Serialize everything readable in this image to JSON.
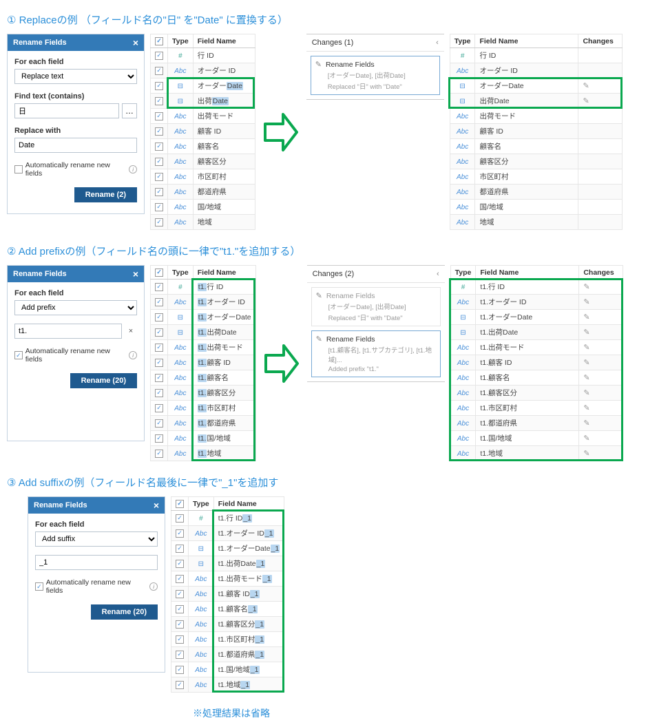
{
  "sec1": {
    "title": "① Replaceの例 （フィールド名の\"日\" を\"Date\" に置換する）",
    "panel": {
      "header": "Rename Fields",
      "forEachLabel": "For each field",
      "forEachSelected": "Replace text",
      "findLabel": "Find text (contains)",
      "findValue": "日",
      "replaceLabel": "Replace with",
      "replaceValue": "Date",
      "autoRename": "Automatically rename new fields",
      "renameBtn": "Rename (2)",
      "autoChecked": false
    },
    "tableHead": {
      "type": "Type",
      "field": "Field Name"
    },
    "rows": [
      {
        "t": "num",
        "name": "行 ID"
      },
      {
        "t": "abc",
        "name": "オーダー ID"
      },
      {
        "t": "dt",
        "name": "オーダー",
        "hl": "Date"
      },
      {
        "t": "dt",
        "name": "出荷",
        "hl": "Date"
      },
      {
        "t": "abc",
        "name": "出荷モード"
      },
      {
        "t": "abc",
        "name": "顧客 ID"
      },
      {
        "t": "abc",
        "name": "顧客名"
      },
      {
        "t": "abc",
        "name": "顧客区分"
      },
      {
        "t": "abc",
        "name": "市区町村"
      },
      {
        "t": "abc",
        "name": "都道府県"
      },
      {
        "t": "abc",
        "name": "国/地域"
      },
      {
        "t": "abc",
        "name": "地域"
      }
    ],
    "changes": {
      "head": "Changes (1)",
      "items": [
        {
          "title": "Rename Fields",
          "sub1": "[オーダーDate], [出荷Date]",
          "sub2": "Replaced \"日\" with \"Date\"",
          "active": true
        }
      ]
    },
    "resultHead": {
      "type": "Type",
      "field": "Field Name",
      "ch": "Changes"
    },
    "result": [
      {
        "t": "num",
        "name": "行 ID",
        "ch": false
      },
      {
        "t": "abc",
        "name": "オーダー ID",
        "ch": false
      },
      {
        "t": "dt",
        "name": "オーダーDate",
        "ch": true
      },
      {
        "t": "dt",
        "name": "出荷Date",
        "ch": true
      },
      {
        "t": "abc",
        "name": "出荷モード",
        "ch": false
      },
      {
        "t": "abc",
        "name": "顧客 ID",
        "ch": false
      },
      {
        "t": "abc",
        "name": "顧客名",
        "ch": false
      },
      {
        "t": "abc",
        "name": "顧客区分",
        "ch": false
      },
      {
        "t": "abc",
        "name": "市区町村",
        "ch": false
      },
      {
        "t": "abc",
        "name": "都道府県",
        "ch": false
      },
      {
        "t": "abc",
        "name": "国/地域",
        "ch": false
      },
      {
        "t": "abc",
        "name": "地域",
        "ch": false
      }
    ]
  },
  "sec2": {
    "title": "② Add prefixの例（フィールド名の頭に一律で\"t1.\"を追加する）",
    "panel": {
      "header": "Rename Fields",
      "forEachLabel": "For each field",
      "forEachSelected": "Add prefix",
      "prefixValue": "t1.",
      "autoRename": "Automatically rename new fields",
      "renameBtn": "Rename (20)",
      "autoChecked": true
    },
    "tableHead": {
      "type": "Type",
      "field": "Field Name"
    },
    "rows": [
      {
        "t": "num",
        "pre": "t1.",
        "name": "行 ID"
      },
      {
        "t": "abc",
        "pre": "t1.",
        "name": "オーダー ID"
      },
      {
        "t": "dt",
        "pre": "t1.",
        "name": "オーダーDate"
      },
      {
        "t": "dt",
        "pre": "t1.",
        "name": "出荷Date"
      },
      {
        "t": "abc",
        "pre": "t1.",
        "name": "出荷モード"
      },
      {
        "t": "abc",
        "pre": "t1.",
        "name": "顧客 ID"
      },
      {
        "t": "abc",
        "pre": "t1.",
        "name": "顧客名"
      },
      {
        "t": "abc",
        "pre": "t1.",
        "name": "顧客区分"
      },
      {
        "t": "abc",
        "pre": "t1.",
        "name": "市区町村"
      },
      {
        "t": "abc",
        "pre": "t1.",
        "name": "都道府県"
      },
      {
        "t": "abc",
        "pre": "t1.",
        "name": "国/地域"
      },
      {
        "t": "abc",
        "pre": "t1.",
        "name": "地域"
      }
    ],
    "changes": {
      "head": "Changes (2)",
      "items": [
        {
          "title": "Rename Fields",
          "sub1": "[オーダーDate], [出荷Date]",
          "sub2": "Replaced \"日\" with \"Date\"",
          "active": false
        },
        {
          "title": "Rename Fields",
          "sub1": "[t1.顧客名], [t1.サブカテゴリ], [t1.地域]...",
          "sub2": "Added prefix \"t1.\"",
          "active": true
        }
      ]
    },
    "resultHead": {
      "type": "Type",
      "field": "Field Name",
      "ch": "Changes"
    },
    "result": [
      {
        "t": "num",
        "name": "t1.行 ID",
        "ch": true
      },
      {
        "t": "abc",
        "name": "t1.オーダー ID",
        "ch": true
      },
      {
        "t": "dt",
        "name": "t1.オーダーDate",
        "ch": true
      },
      {
        "t": "dt",
        "name": "t1.出荷Date",
        "ch": true
      },
      {
        "t": "abc",
        "name": "t1.出荷モード",
        "ch": true
      },
      {
        "t": "abc",
        "name": "t1.顧客 ID",
        "ch": true
      },
      {
        "t": "abc",
        "name": "t1.顧客名",
        "ch": true
      },
      {
        "t": "abc",
        "name": "t1.顧客区分",
        "ch": true
      },
      {
        "t": "abc",
        "name": "t1.市区町村",
        "ch": true
      },
      {
        "t": "abc",
        "name": "t1.都道府県",
        "ch": true
      },
      {
        "t": "abc",
        "name": "t1.国/地域",
        "ch": true
      },
      {
        "t": "abc",
        "name": "t1.地域",
        "ch": true
      }
    ]
  },
  "sec3": {
    "title": "③ Add suffixの例（フィールド名最後に一律で\"_1\"を追加す",
    "panel": {
      "header": "Rename Fields",
      "forEachLabel": "For each field",
      "forEachSelected": "Add suffix",
      "suffixValue": "_1",
      "autoRename": "Automatically rename new fields",
      "renameBtn": "Rename (20)",
      "autoChecked": true
    },
    "tableHead": {
      "type": "Type",
      "field": "Field Name"
    },
    "rows": [
      {
        "t": "num",
        "name": "t1.行 ID",
        "suf": "_1"
      },
      {
        "t": "abc",
        "name": "t1.オーダー ID",
        "suf": "_1"
      },
      {
        "t": "dt",
        "name": "t1.オーダーDate",
        "suf": "_1"
      },
      {
        "t": "dt",
        "name": "t1.出荷Date",
        "suf": "_1"
      },
      {
        "t": "abc",
        "name": "t1.出荷モード",
        "suf": "_1"
      },
      {
        "t": "abc",
        "name": "t1.顧客 ID",
        "suf": "_1"
      },
      {
        "t": "abc",
        "name": "t1.顧客名",
        "suf": "_1"
      },
      {
        "t": "abc",
        "name": "t1.顧客区分",
        "suf": "_1"
      },
      {
        "t": "abc",
        "name": "t1.市区町村",
        "suf": "_1"
      },
      {
        "t": "abc",
        "name": "t1.都道府県",
        "suf": "_1"
      },
      {
        "t": "abc",
        "name": "t1.国/地域",
        "suf": "_1"
      },
      {
        "t": "abc",
        "name": "t1.地域",
        "suf": "_1"
      }
    ],
    "footnote": "※処理結果は省略"
  },
  "typeIcons": {
    "num": "#",
    "abc": "Abc",
    "dt": "⊟"
  }
}
